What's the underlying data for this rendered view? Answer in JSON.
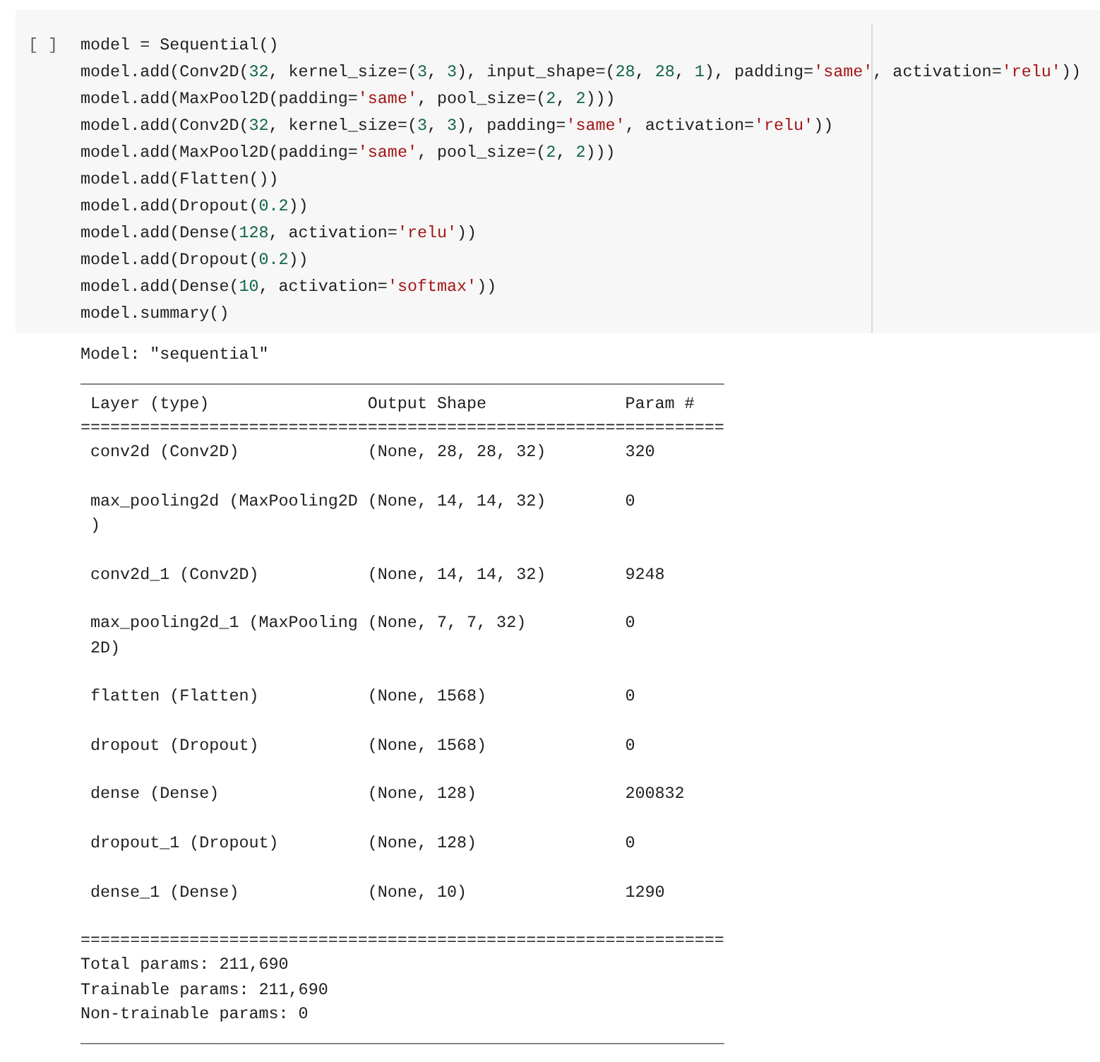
{
  "cell": {
    "execution_count": "[ ]",
    "code_lines": [
      [
        {
          "text": "model = Sequential()",
          "kind": "plain"
        }
      ],
      [
        {
          "text": "model.add(Conv2D(",
          "kind": "plain"
        },
        {
          "text": "32",
          "kind": "number"
        },
        {
          "text": ", kernel_size=(",
          "kind": "plain"
        },
        {
          "text": "3",
          "kind": "number"
        },
        {
          "text": ", ",
          "kind": "plain"
        },
        {
          "text": "3",
          "kind": "number"
        },
        {
          "text": "), input_shape=(",
          "kind": "plain"
        },
        {
          "text": "28",
          "kind": "number"
        },
        {
          "text": ", ",
          "kind": "plain"
        },
        {
          "text": "28",
          "kind": "number"
        },
        {
          "text": ", ",
          "kind": "plain"
        },
        {
          "text": "1",
          "kind": "number"
        },
        {
          "text": "), padding=",
          "kind": "plain"
        },
        {
          "text": "'same'",
          "kind": "string"
        },
        {
          "text": ", activation=",
          "kind": "plain"
        },
        {
          "text": "'relu'",
          "kind": "string"
        },
        {
          "text": "))",
          "kind": "plain"
        }
      ],
      [
        {
          "text": "model.add(MaxPool2D(padding=",
          "kind": "plain"
        },
        {
          "text": "'same'",
          "kind": "string"
        },
        {
          "text": ", pool_size=(",
          "kind": "plain"
        },
        {
          "text": "2",
          "kind": "number"
        },
        {
          "text": ", ",
          "kind": "plain"
        },
        {
          "text": "2",
          "kind": "number"
        },
        {
          "text": ")))",
          "kind": "plain"
        }
      ],
      [
        {
          "text": "model.add(Conv2D(",
          "kind": "plain"
        },
        {
          "text": "32",
          "kind": "number"
        },
        {
          "text": ", kernel_size=(",
          "kind": "plain"
        },
        {
          "text": "3",
          "kind": "number"
        },
        {
          "text": ", ",
          "kind": "plain"
        },
        {
          "text": "3",
          "kind": "number"
        },
        {
          "text": "), padding=",
          "kind": "plain"
        },
        {
          "text": "'same'",
          "kind": "string"
        },
        {
          "text": ", activation=",
          "kind": "plain"
        },
        {
          "text": "'relu'",
          "kind": "string"
        },
        {
          "text": "))",
          "kind": "plain"
        }
      ],
      [
        {
          "text": "model.add(MaxPool2D(padding=",
          "kind": "plain"
        },
        {
          "text": "'same'",
          "kind": "string"
        },
        {
          "text": ", pool_size=(",
          "kind": "plain"
        },
        {
          "text": "2",
          "kind": "number"
        },
        {
          "text": ", ",
          "kind": "plain"
        },
        {
          "text": "2",
          "kind": "number"
        },
        {
          "text": ")))",
          "kind": "plain"
        }
      ],
      [
        {
          "text": "model.add(Flatten())",
          "kind": "plain"
        }
      ],
      [
        {
          "text": "model.add(Dropout(",
          "kind": "plain"
        },
        {
          "text": "0.2",
          "kind": "number"
        },
        {
          "text": "))",
          "kind": "plain"
        }
      ],
      [
        {
          "text": "model.add(Dense(",
          "kind": "plain"
        },
        {
          "text": "128",
          "kind": "number"
        },
        {
          "text": ", activation=",
          "kind": "plain"
        },
        {
          "text": "'relu'",
          "kind": "string"
        },
        {
          "text": "))",
          "kind": "plain"
        }
      ],
      [
        {
          "text": "model.add(Dropout(",
          "kind": "plain"
        },
        {
          "text": "0.2",
          "kind": "number"
        },
        {
          "text": "))",
          "kind": "plain"
        }
      ],
      [
        {
          "text": "model.add(Dense(",
          "kind": "plain"
        },
        {
          "text": "10",
          "kind": "number"
        },
        {
          "text": ", activation=",
          "kind": "plain"
        },
        {
          "text": "'softmax'",
          "kind": "string"
        },
        {
          "text": "))",
          "kind": "plain"
        }
      ],
      [
        {
          "text": "model.summary()",
          "kind": "plain"
        }
      ]
    ]
  },
  "output": {
    "model_line": "Model: \"sequential\"",
    "divider_top": "_________________________________________________________________",
    "table": {
      "columns": [
        "Layer (type)",
        "Output Shape",
        "Param #"
      ],
      "divider": "=================================================================",
      "rows": [
        {
          "layer": "conv2d (Conv2D)",
          "output_shape": "(None, 28, 28, 32)",
          "params": "320"
        },
        {
          "layer": "max_pooling2d (MaxPooling2D\n)",
          "output_shape": "(None, 14, 14, 32)",
          "params": "0"
        },
        {
          "layer": "conv2d_1 (Conv2D)",
          "output_shape": "(None, 14, 14, 32)",
          "params": "9248"
        },
        {
          "layer": "max_pooling2d_1 (MaxPooling\n2D)",
          "output_shape": "(None, 7, 7, 32)",
          "params": "0"
        },
        {
          "layer": "flatten (Flatten)",
          "output_shape": "(None, 1568)",
          "params": "0"
        },
        {
          "layer": "dropout (Dropout)",
          "output_shape": "(None, 1568)",
          "params": "0"
        },
        {
          "layer": "dense (Dense)",
          "output_shape": "(None, 128)",
          "params": "200832"
        },
        {
          "layer": "dropout_1 (Dropout)",
          "output_shape": "(None, 128)",
          "params": "0"
        },
        {
          "layer": "dense_1 (Dense)",
          "output_shape": "(None, 10)",
          "params": "1290"
        }
      ]
    },
    "divider_bottom": "=================================================================",
    "totals": [
      "Total params: 211,690",
      "Trainable params: 211,690",
      "Non-trainable params: 0"
    ],
    "divider_end": "_________________________________________________________________"
  }
}
